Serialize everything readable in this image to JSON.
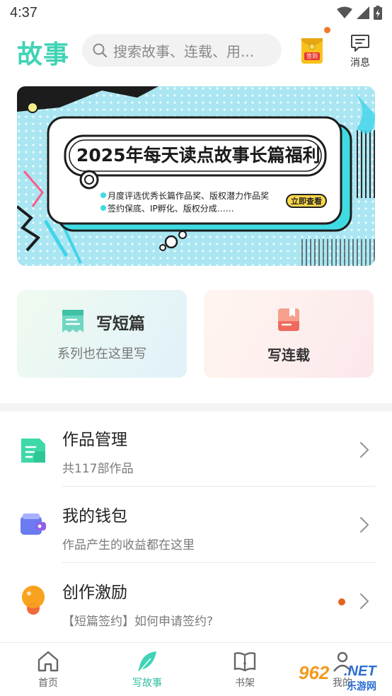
{
  "status_bar": {
    "time": "4:37"
  },
  "header": {
    "logo": "故事",
    "search_placeholder": "搜索故事、连载、用...",
    "signin_label": "签到",
    "messages_label": "消息"
  },
  "banner": {
    "title": "2025年每天读点故事长篇福利",
    "lines": [
      "月度评选优秀长篇作品奖、版权潜力作品奖",
      "签约保底、IP孵化、版权分成……"
    ],
    "button": "立即查看"
  },
  "cards": {
    "short": {
      "title": "写短篇",
      "subtitle": "系列也在这里写"
    },
    "serial": {
      "title": "写连载"
    }
  },
  "list": [
    {
      "title": "作品管理",
      "subtitle": "共117部作品"
    },
    {
      "title": "我的钱包",
      "subtitle": "作品产生的收益都在这里"
    },
    {
      "title": "创作激励",
      "subtitle": "【短篇签约】如何申请签约?"
    }
  ],
  "bottom_nav": [
    {
      "label": "首页",
      "icon": "home-icon",
      "active": false
    },
    {
      "label": "写故事",
      "icon": "feather-icon",
      "active": true
    },
    {
      "label": "书架",
      "icon": "book-icon",
      "active": false
    },
    {
      "label": "我的",
      "icon": "user-icon",
      "active": false
    }
  ],
  "watermark": {
    "number": "962",
    "net": ".NET",
    "cn": "乐游网"
  },
  "colors": {
    "accent": "#2fbfa1",
    "logo": "#3fd3b5",
    "dot": "#e5641e"
  }
}
